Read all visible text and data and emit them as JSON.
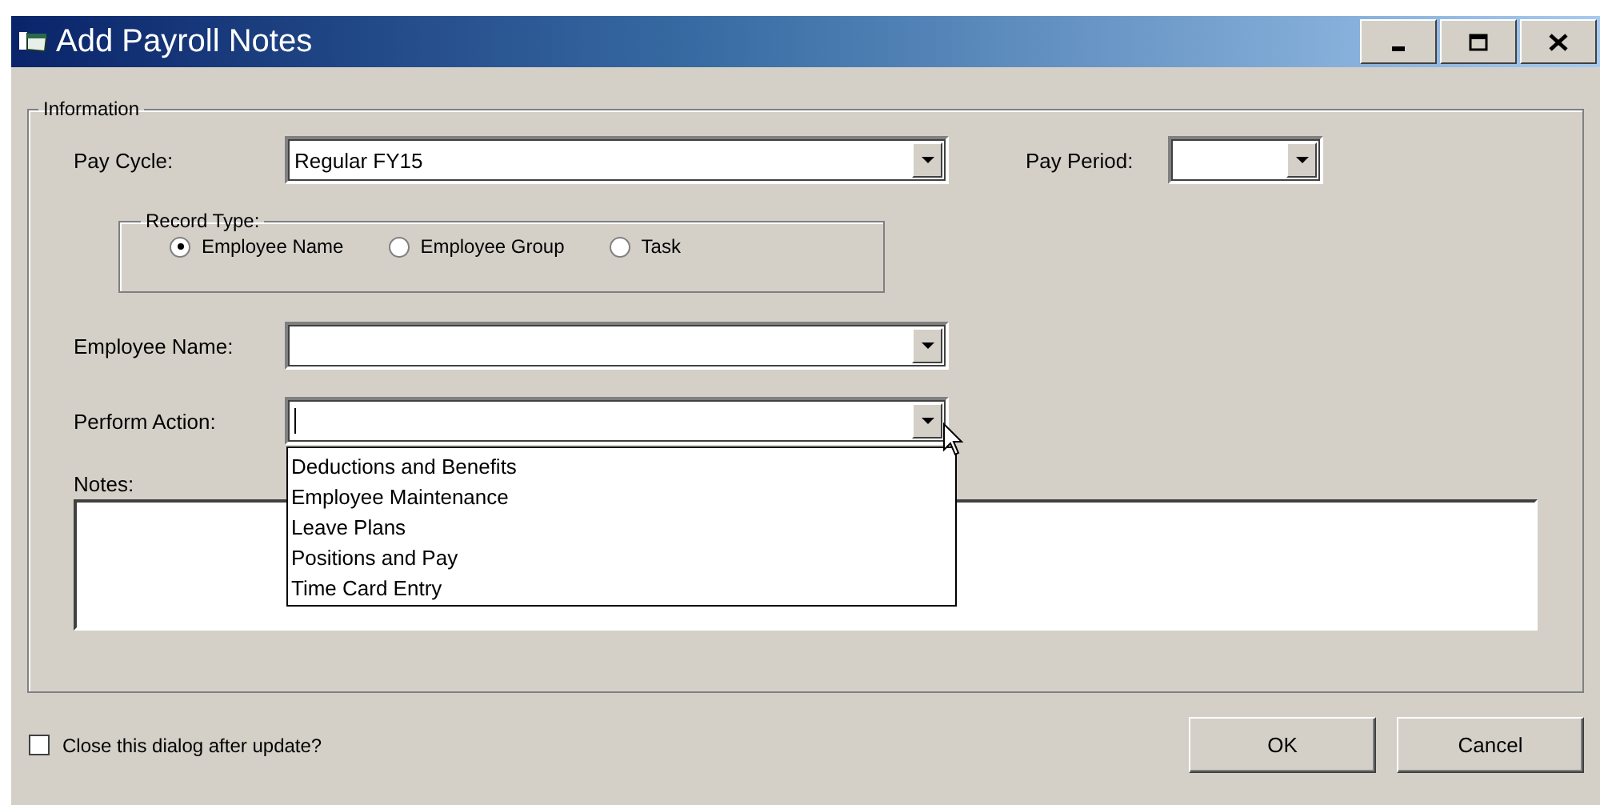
{
  "window": {
    "title": "Add Payroll Notes"
  },
  "information": {
    "legend": "Information",
    "pay_cycle": {
      "label": "Pay Cycle:",
      "value": "Regular FY15"
    },
    "pay_period": {
      "label": "Pay Period:"
    },
    "record_type": {
      "legend": "Record Type:",
      "options": [
        {
          "label": "Employee Name",
          "selected": true
        },
        {
          "label": "Employee Group",
          "selected": false
        },
        {
          "label": "Task",
          "selected": false
        }
      ]
    },
    "employee_name": {
      "label": "Employee Name:"
    },
    "perform_action": {
      "label": "Perform Action:",
      "expanded": true,
      "options": [
        "Deductions and Benefits",
        "Employee Maintenance",
        "Leave Plans",
        "Positions and Pay",
        "Time Card Entry"
      ]
    },
    "notes": {
      "label": "Notes:"
    }
  },
  "close_after_update": {
    "label": "Close this dialog after update?",
    "checked": false
  },
  "buttons": [
    {
      "label": "OK"
    },
    {
      "label": "Cancel"
    }
  ]
}
